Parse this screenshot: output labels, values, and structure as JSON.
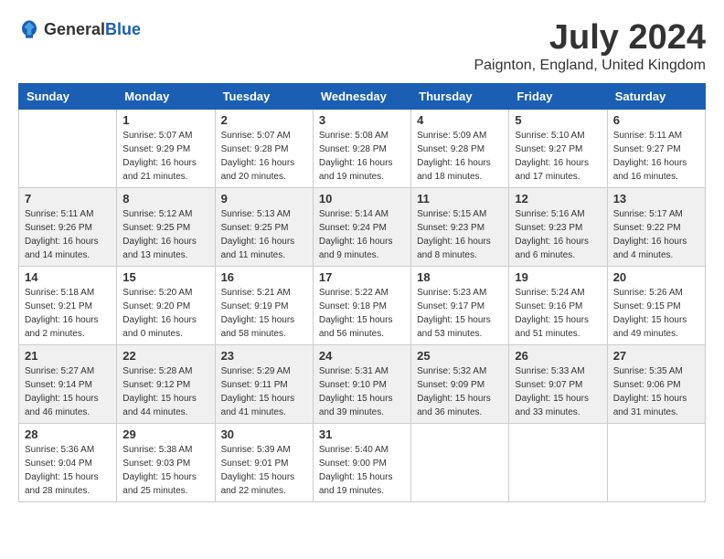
{
  "header": {
    "logo_general": "General",
    "logo_blue": "Blue",
    "month_year": "July 2024",
    "location": "Paignton, England, United Kingdom"
  },
  "days_of_week": [
    "Sunday",
    "Monday",
    "Tuesday",
    "Wednesday",
    "Thursday",
    "Friday",
    "Saturday"
  ],
  "weeks": [
    [
      {
        "day": "",
        "sunrise": "",
        "sunset": "",
        "daylight": ""
      },
      {
        "day": "1",
        "sunrise": "Sunrise: 5:07 AM",
        "sunset": "Sunset: 9:29 PM",
        "daylight": "Daylight: 16 hours and 21 minutes."
      },
      {
        "day": "2",
        "sunrise": "Sunrise: 5:07 AM",
        "sunset": "Sunset: 9:28 PM",
        "daylight": "Daylight: 16 hours and 20 minutes."
      },
      {
        "day": "3",
        "sunrise": "Sunrise: 5:08 AM",
        "sunset": "Sunset: 9:28 PM",
        "daylight": "Daylight: 16 hours and 19 minutes."
      },
      {
        "day": "4",
        "sunrise": "Sunrise: 5:09 AM",
        "sunset": "Sunset: 9:28 PM",
        "daylight": "Daylight: 16 hours and 18 minutes."
      },
      {
        "day": "5",
        "sunrise": "Sunrise: 5:10 AM",
        "sunset": "Sunset: 9:27 PM",
        "daylight": "Daylight: 16 hours and 17 minutes."
      },
      {
        "day": "6",
        "sunrise": "Sunrise: 5:11 AM",
        "sunset": "Sunset: 9:27 PM",
        "daylight": "Daylight: 16 hours and 16 minutes."
      }
    ],
    [
      {
        "day": "7",
        "sunrise": "Sunrise: 5:11 AM",
        "sunset": "Sunset: 9:26 PM",
        "daylight": "Daylight: 16 hours and 14 minutes."
      },
      {
        "day": "8",
        "sunrise": "Sunrise: 5:12 AM",
        "sunset": "Sunset: 9:25 PM",
        "daylight": "Daylight: 16 hours and 13 minutes."
      },
      {
        "day": "9",
        "sunrise": "Sunrise: 5:13 AM",
        "sunset": "Sunset: 9:25 PM",
        "daylight": "Daylight: 16 hours and 11 minutes."
      },
      {
        "day": "10",
        "sunrise": "Sunrise: 5:14 AM",
        "sunset": "Sunset: 9:24 PM",
        "daylight": "Daylight: 16 hours and 9 minutes."
      },
      {
        "day": "11",
        "sunrise": "Sunrise: 5:15 AM",
        "sunset": "Sunset: 9:23 PM",
        "daylight": "Daylight: 16 hours and 8 minutes."
      },
      {
        "day": "12",
        "sunrise": "Sunrise: 5:16 AM",
        "sunset": "Sunset: 9:23 PM",
        "daylight": "Daylight: 16 hours and 6 minutes."
      },
      {
        "day": "13",
        "sunrise": "Sunrise: 5:17 AM",
        "sunset": "Sunset: 9:22 PM",
        "daylight": "Daylight: 16 hours and 4 minutes."
      }
    ],
    [
      {
        "day": "14",
        "sunrise": "Sunrise: 5:18 AM",
        "sunset": "Sunset: 9:21 PM",
        "daylight": "Daylight: 16 hours and 2 minutes."
      },
      {
        "day": "15",
        "sunrise": "Sunrise: 5:20 AM",
        "sunset": "Sunset: 9:20 PM",
        "daylight": "Daylight: 16 hours and 0 minutes."
      },
      {
        "day": "16",
        "sunrise": "Sunrise: 5:21 AM",
        "sunset": "Sunset: 9:19 PM",
        "daylight": "Daylight: 15 hours and 58 minutes."
      },
      {
        "day": "17",
        "sunrise": "Sunrise: 5:22 AM",
        "sunset": "Sunset: 9:18 PM",
        "daylight": "Daylight: 15 hours and 56 minutes."
      },
      {
        "day": "18",
        "sunrise": "Sunrise: 5:23 AM",
        "sunset": "Sunset: 9:17 PM",
        "daylight": "Daylight: 15 hours and 53 minutes."
      },
      {
        "day": "19",
        "sunrise": "Sunrise: 5:24 AM",
        "sunset": "Sunset: 9:16 PM",
        "daylight": "Daylight: 15 hours and 51 minutes."
      },
      {
        "day": "20",
        "sunrise": "Sunrise: 5:26 AM",
        "sunset": "Sunset: 9:15 PM",
        "daylight": "Daylight: 15 hours and 49 minutes."
      }
    ],
    [
      {
        "day": "21",
        "sunrise": "Sunrise: 5:27 AM",
        "sunset": "Sunset: 9:14 PM",
        "daylight": "Daylight: 15 hours and 46 minutes."
      },
      {
        "day": "22",
        "sunrise": "Sunrise: 5:28 AM",
        "sunset": "Sunset: 9:12 PM",
        "daylight": "Daylight: 15 hours and 44 minutes."
      },
      {
        "day": "23",
        "sunrise": "Sunrise: 5:29 AM",
        "sunset": "Sunset: 9:11 PM",
        "daylight": "Daylight: 15 hours and 41 minutes."
      },
      {
        "day": "24",
        "sunrise": "Sunrise: 5:31 AM",
        "sunset": "Sunset: 9:10 PM",
        "daylight": "Daylight: 15 hours and 39 minutes."
      },
      {
        "day": "25",
        "sunrise": "Sunrise: 5:32 AM",
        "sunset": "Sunset: 9:09 PM",
        "daylight": "Daylight: 15 hours and 36 minutes."
      },
      {
        "day": "26",
        "sunrise": "Sunrise: 5:33 AM",
        "sunset": "Sunset: 9:07 PM",
        "daylight": "Daylight: 15 hours and 33 minutes."
      },
      {
        "day": "27",
        "sunrise": "Sunrise: 5:35 AM",
        "sunset": "Sunset: 9:06 PM",
        "daylight": "Daylight: 15 hours and 31 minutes."
      }
    ],
    [
      {
        "day": "28",
        "sunrise": "Sunrise: 5:36 AM",
        "sunset": "Sunset: 9:04 PM",
        "daylight": "Daylight: 15 hours and 28 minutes."
      },
      {
        "day": "29",
        "sunrise": "Sunrise: 5:38 AM",
        "sunset": "Sunset: 9:03 PM",
        "daylight": "Daylight: 15 hours and 25 minutes."
      },
      {
        "day": "30",
        "sunrise": "Sunrise: 5:39 AM",
        "sunset": "Sunset: 9:01 PM",
        "daylight": "Daylight: 15 hours and 22 minutes."
      },
      {
        "day": "31",
        "sunrise": "Sunrise: 5:40 AM",
        "sunset": "Sunset: 9:00 PM",
        "daylight": "Daylight: 15 hours and 19 minutes."
      },
      {
        "day": "",
        "sunrise": "",
        "sunset": "",
        "daylight": ""
      },
      {
        "day": "",
        "sunrise": "",
        "sunset": "",
        "daylight": ""
      },
      {
        "day": "",
        "sunrise": "",
        "sunset": "",
        "daylight": ""
      }
    ]
  ]
}
